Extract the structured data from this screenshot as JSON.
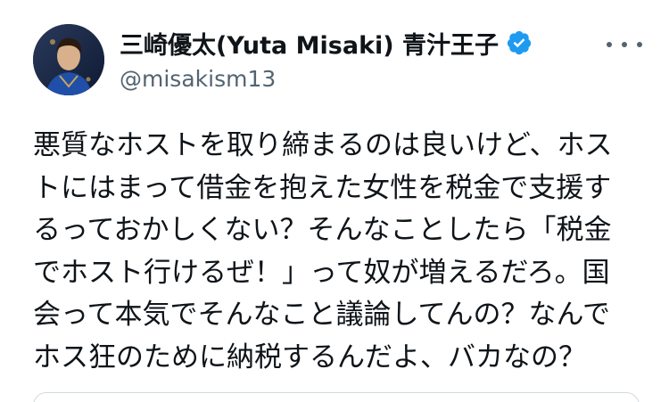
{
  "tweet": {
    "author": {
      "display_name": "三崎優太(Yuta Misaki) 青汁王子",
      "handle": "@misakism13",
      "verified": true,
      "avatar_icon": "profile-photo"
    },
    "more_icon": "more-horizontal-icon",
    "body_lines": [
      "悪質なホストを取り締まるのは良いけど、ホス",
      "トにはまって借金を抱えた女性を税金で支援す",
      "るっておかしくない？そんなことしたら「税金",
      "でホスト行けるぜ！」って奴が増えるだろ。国",
      "会って本気でそんなこと議論してんの？なんで",
      "ホス狂のために納税するんだよ、バカなの？"
    ]
  },
  "colors": {
    "text": "#0f1419",
    "secondary_text": "#536471",
    "verified_badge": "#1d9bf0",
    "background": "#ffffff"
  }
}
